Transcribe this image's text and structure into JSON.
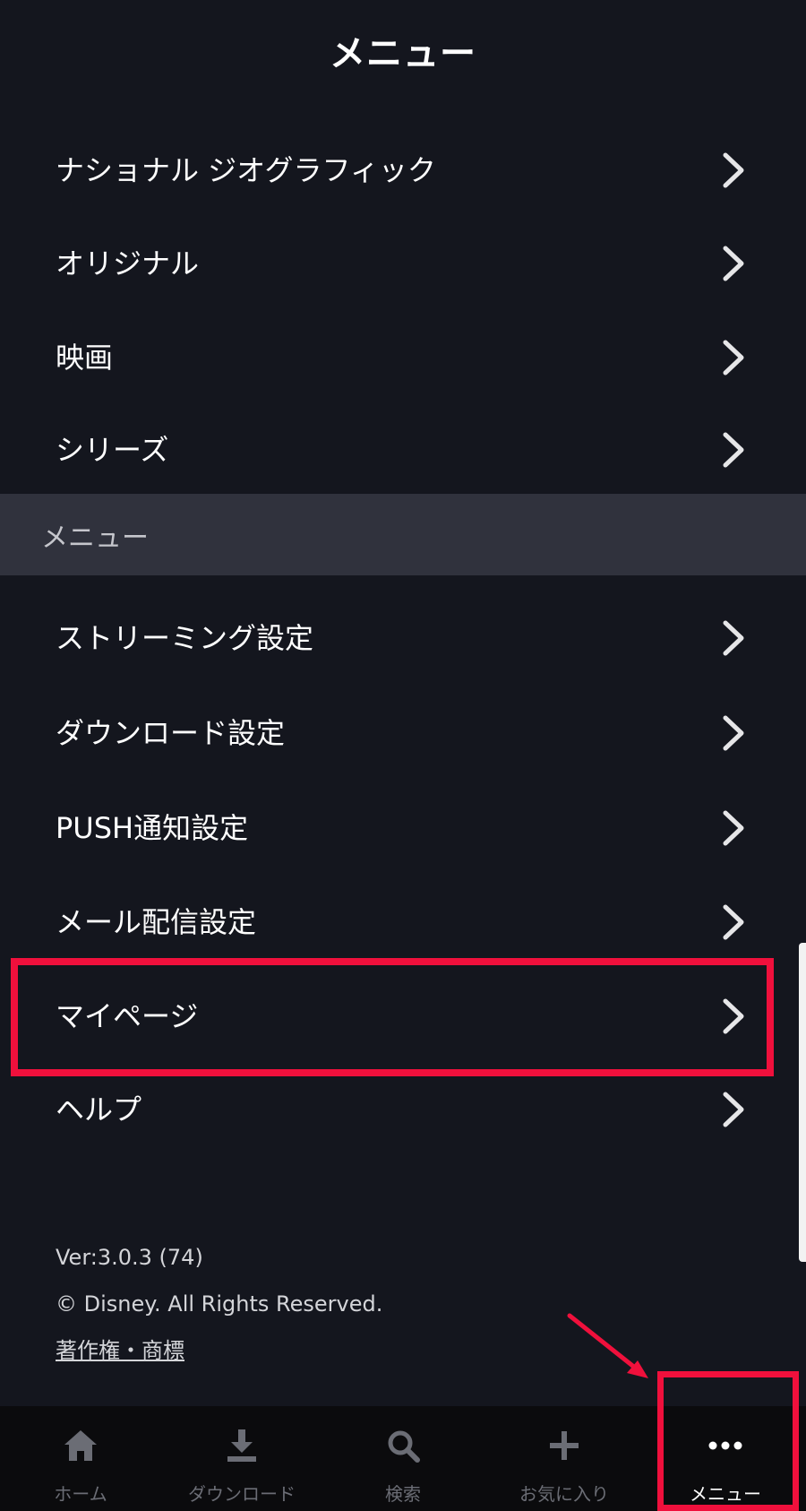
{
  "header": {
    "title": "メニュー"
  },
  "category_items": [
    {
      "label": "ナショナル ジオグラフィック"
    },
    {
      "label": "オリジナル"
    },
    {
      "label": "映画"
    },
    {
      "label": "シリーズ"
    }
  ],
  "section_header": {
    "label": "メニュー"
  },
  "settings_items": [
    {
      "label": "ストリーミング設定"
    },
    {
      "label": "ダウンロード設定"
    },
    {
      "label": "PUSH通知設定"
    },
    {
      "label": "メール配信設定"
    },
    {
      "label": "マイページ",
      "highlighted": true
    },
    {
      "label": "ヘルプ"
    }
  ],
  "footer": {
    "version": "Ver:3.0.3 (74)",
    "copyright": "© Disney. All Rights Reserved.",
    "trademark_link": "著作権・商標"
  },
  "bottom_nav": {
    "active": "メニュー",
    "items": [
      {
        "label": "ホーム",
        "icon": "home-icon"
      },
      {
        "label": "ダウンロード",
        "icon": "download-icon"
      },
      {
        "label": "検索",
        "icon": "search-icon"
      },
      {
        "label": "お気に入り",
        "icon": "plus-icon"
      },
      {
        "label": "メニュー",
        "icon": "more-dots-icon"
      }
    ]
  },
  "colors": {
    "background": "#14161e",
    "section_header_bg": "#30323d",
    "nav_bg": "#0b0b0d",
    "annotation_red": "#f0103c",
    "nav_inactive": "#6b6d75"
  }
}
